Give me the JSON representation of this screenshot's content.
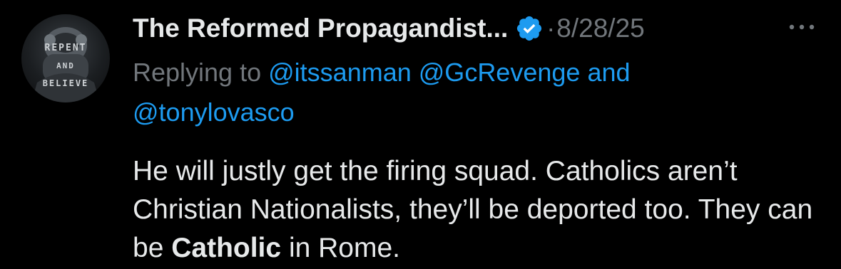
{
  "author": {
    "display_name": "The Reformed Propagandist...",
    "verified": true,
    "avatar_text": [
      "REPENT",
      "AND",
      "BELIEVE"
    ]
  },
  "meta": {
    "separator": "·",
    "timestamp": "8/28/25",
    "more_icon": "more-horizontal-icon"
  },
  "reply_context": {
    "prefix": "Replying to",
    "mention_1": "@itssanman",
    "mention_2": "@GcRevenge",
    "conjunction": "and",
    "mention_3": "@tonylovasco"
  },
  "tweet": {
    "text_before": "He will justly get the firing squad. Catholics aren’t Christian Nationalists, they’ll be deported too. They can be",
    "text_bold": "Catholic",
    "text_after": "in Rome."
  },
  "colors": {
    "background": "#000000",
    "text_primary": "#e7e9ea",
    "text_secondary": "#71767b",
    "accent": "#1d9bf0"
  }
}
